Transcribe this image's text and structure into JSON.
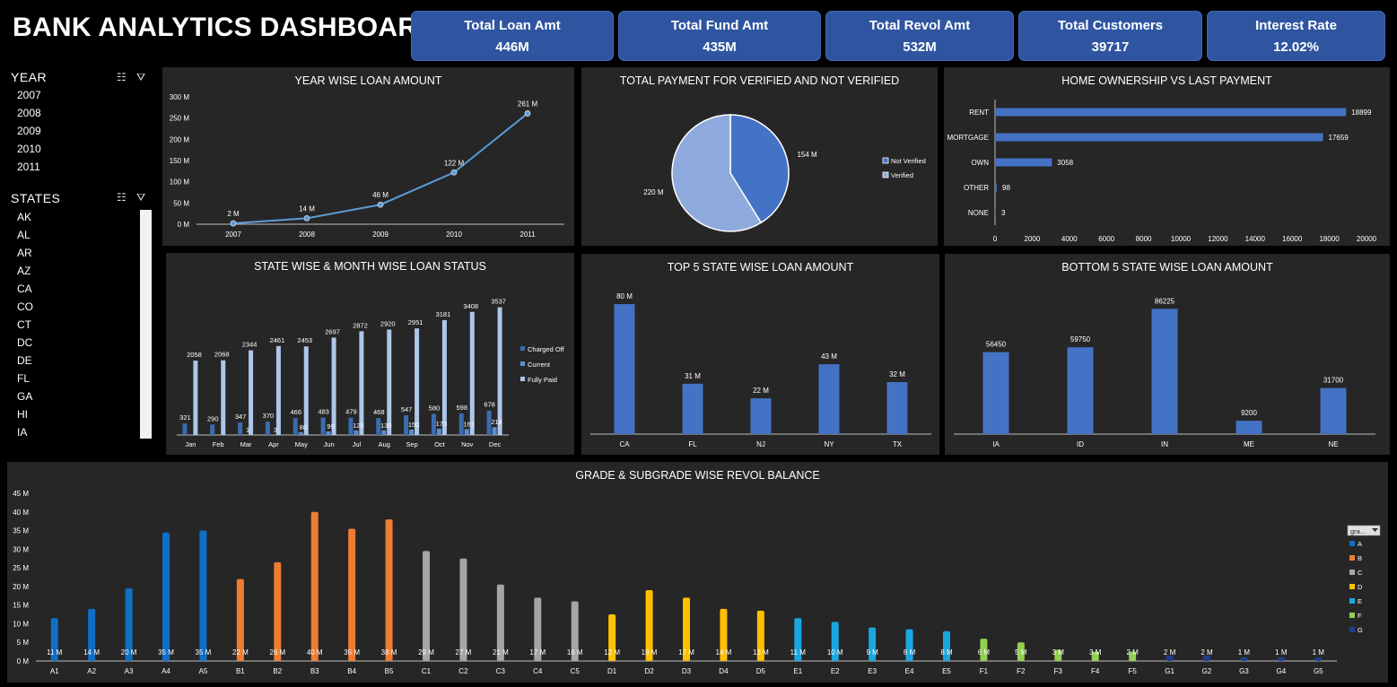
{
  "dashboard": {
    "title": "BANK ANALYTICS DASHBOARD"
  },
  "kpis": [
    {
      "label": "Total Loan Amt",
      "value": "446M"
    },
    {
      "label": "Total Fund Amt",
      "value": "435M"
    },
    {
      "label": "Total Revol Amt",
      "value": "532M"
    },
    {
      "label": "Total Customers",
      "value": "39717"
    },
    {
      "label": "Interest Rate",
      "value": "12.02%"
    }
  ],
  "slicers": {
    "year": {
      "title": "YEAR",
      "items": [
        "2007",
        "2008",
        "2009",
        "2010",
        "2011"
      ]
    },
    "states": {
      "title": "STATES",
      "items": [
        "AK",
        "AL",
        "AR",
        "AZ",
        "CA",
        "CO",
        "CT",
        "DC",
        "DE",
        "FL",
        "GA",
        "HI",
        "IA"
      ]
    },
    "icons": [
      "multi-select-icon",
      "clear-filter-icon"
    ]
  },
  "colors": {
    "panel": "#262626",
    "kpi": "#2f55a0",
    "bar": "#4472c4",
    "line": "#5b9bd5",
    "pie_light": "#8faadc",
    "charged_off": "#3a6cb0",
    "current": "#5b8ed0",
    "fully_paid": "#aec6ea",
    "grade_A": "#0f6fc6",
    "grade_B": "#ed7d31",
    "grade_C": "#a5a5a5",
    "grade_D": "#ffc000",
    "grade_E": "#1aa7e0",
    "grade_F": "#92d050",
    "grade_G": "#1f3e8c"
  },
  "chart_data": [
    {
      "id": "year_loan",
      "type": "line",
      "title": "YEAR WISE LOAN AMOUNT",
      "categories": [
        "2007",
        "2008",
        "2009",
        "2010",
        "2011"
      ],
      "values": [
        2,
        14,
        46,
        122,
        261
      ],
      "data_labels": [
        "2 M",
        "14 M",
        "46 M",
        "122 M",
        "261 M"
      ],
      "yticks": [
        "0 M",
        "50 M",
        "100 M",
        "150 M",
        "200 M",
        "250 M",
        "300 M"
      ],
      "ylim": [
        0,
        300
      ]
    },
    {
      "id": "verified_pie",
      "type": "pie",
      "title": "TOTAL PAYMENT FOR VERIFIED AND NOT VERIFIED",
      "labels": [
        "Not Verified",
        "Verified"
      ],
      "values": [
        154,
        220
      ],
      "data_labels": [
        "154 M",
        "220 M"
      ]
    },
    {
      "id": "home_ownership",
      "type": "bar",
      "orientation": "horizontal",
      "title": "HOME OWNERSHIP VS LAST PAYMENT",
      "categories": [
        "RENT",
        "MORTGAGE",
        "OWN",
        "OTHER",
        "NONE"
      ],
      "values": [
        18899,
        17659,
        3058,
        98,
        3
      ],
      "xticks": [
        "0",
        "2000",
        "4000",
        "6000",
        "8000",
        "10000",
        "12000",
        "14000",
        "16000",
        "18000",
        "20000"
      ],
      "xlim": [
        0,
        20000
      ]
    },
    {
      "id": "month_status",
      "type": "bar",
      "title": "STATE WISE & MONTH WISE LOAN STATUS",
      "categories": [
        "Jan",
        "Feb",
        "Mar",
        "Apr",
        "May",
        "Jun",
        "Jul",
        "Aug",
        "Sep",
        "Oct",
        "Nov",
        "Dec"
      ],
      "series": [
        {
          "name": "Charged Off",
          "values": [
            321,
            290,
            347,
            370,
            466,
            483,
            479,
            468,
            547,
            580,
            598,
            678
          ]
        },
        {
          "name": "Current",
          "values": [
            0,
            0,
            1,
            3,
            80,
            99,
            125,
            130,
            150,
            173,
            161,
            218
          ]
        },
        {
          "name": "Fully Paid",
          "values": [
            2058,
            2068,
            2344,
            2461,
            2453,
            2697,
            2872,
            2920,
            2951,
            3181,
            3408,
            3537
          ]
        }
      ],
      "ylim": [
        0,
        3700
      ]
    },
    {
      "id": "top5",
      "type": "bar",
      "title": "TOP 5 STATE WISE LOAN AMOUNT",
      "categories": [
        "CA",
        "FL",
        "NJ",
        "NY",
        "TX"
      ],
      "values": [
        80,
        31,
        22,
        43,
        32
      ],
      "data_labels": [
        "80 M",
        "31 M",
        "22 M",
        "43 M",
        "32 M"
      ],
      "ylim": [
        0,
        85
      ]
    },
    {
      "id": "bottom5",
      "type": "bar",
      "title": "BOTTOM 5 STATE WISE LOAN AMOUNT",
      "categories": [
        "IA",
        "ID",
        "IN",
        "ME",
        "NE"
      ],
      "values": [
        56450,
        59750,
        86225,
        9200,
        31700
      ],
      "data_labels": [
        "56450",
        "59750",
        "86225",
        "9200",
        "31700"
      ],
      "ylim": [
        0,
        92000
      ]
    },
    {
      "id": "grade_revol",
      "type": "bar",
      "title": "GRADE & SUBGRADE WISE REVOL BALANCE",
      "categories": [
        "A1",
        "A2",
        "A3",
        "A4",
        "A5",
        "B1",
        "B2",
        "B3",
        "B4",
        "B5",
        "C1",
        "C2",
        "C3",
        "C4",
        "C5",
        "D1",
        "D2",
        "D3",
        "D4",
        "D5",
        "E1",
        "E2",
        "E3",
        "E4",
        "E5",
        "F1",
        "F2",
        "F3",
        "F4",
        "F5",
        "G1",
        "G2",
        "G3",
        "G4",
        "G5"
      ],
      "values": [
        11.5,
        14,
        19.5,
        34.5,
        35,
        22,
        26.5,
        40,
        35.5,
        38,
        29.5,
        27.5,
        20.5,
        17,
        16,
        12.5,
        19,
        17,
        14,
        13.5,
        11.5,
        10.5,
        9,
        8.5,
        8,
        6,
        5,
        3,
        2.5,
        2.5,
        1.5,
        1.5,
        1,
        1,
        1
      ],
      "data_labels": [
        "11 M",
        "14 M",
        "20 M",
        "35 M",
        "35 M",
        "22 M",
        "26 M",
        "40 M",
        "35 M",
        "38 M",
        "29 M",
        "27 M",
        "21 M",
        "17 M",
        "16 M",
        "12 M",
        "19 M",
        "17 M",
        "14 M",
        "13 M",
        "11 M",
        "10 M",
        "9 M",
        "8 M",
        "8 M",
        "6 M",
        "5 M",
        "3 M",
        "3 M",
        "2 M",
        "2 M",
        "2 M",
        "1 M",
        "1 M",
        "1 M"
      ],
      "grades": [
        "A",
        "A",
        "A",
        "A",
        "A",
        "B",
        "B",
        "B",
        "B",
        "B",
        "C",
        "C",
        "C",
        "C",
        "C",
        "D",
        "D",
        "D",
        "D",
        "D",
        "E",
        "E",
        "E",
        "E",
        "E",
        "F",
        "F",
        "F",
        "F",
        "F",
        "G",
        "G",
        "G",
        "G",
        "G"
      ],
      "legend_title": "gra...",
      "legend": [
        "A",
        "B",
        "C",
        "D",
        "E",
        "F",
        "G"
      ],
      "yticks": [
        "0 M",
        "5 M",
        "10 M",
        "15 M",
        "20 M",
        "25 M",
        "30 M",
        "35 M",
        "40 M",
        "45 M"
      ],
      "ylim": [
        0,
        45
      ]
    }
  ]
}
